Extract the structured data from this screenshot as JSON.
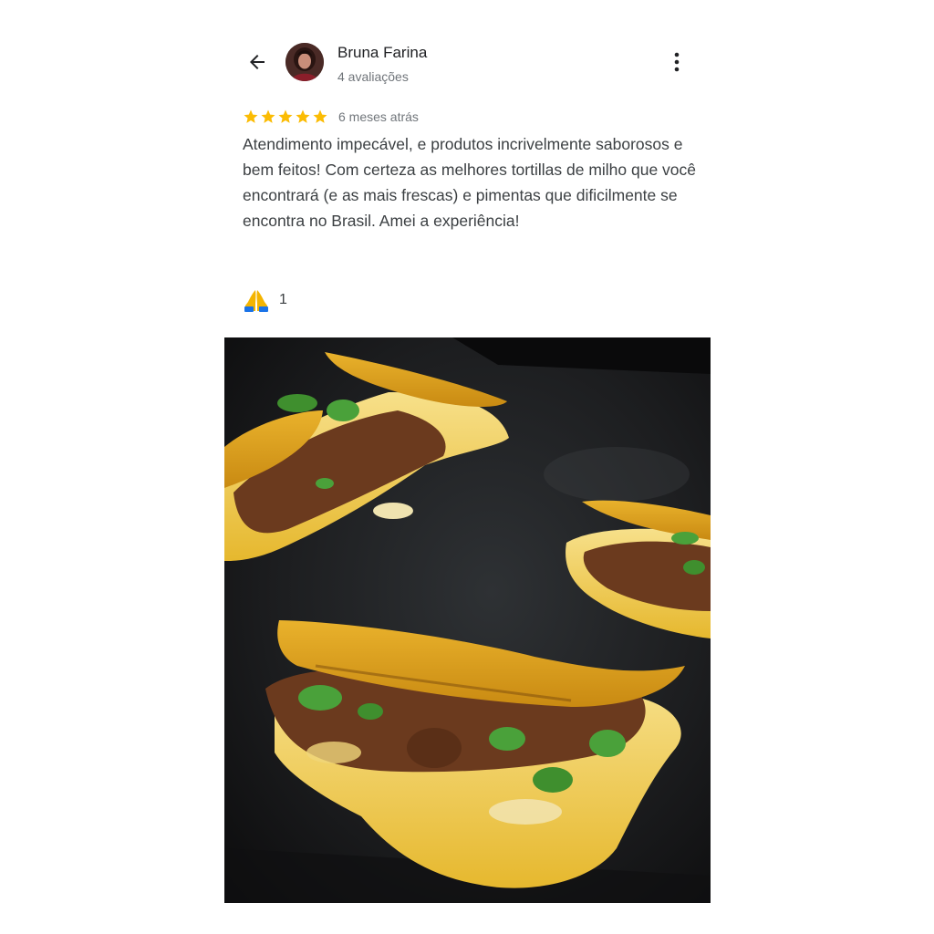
{
  "review": {
    "author": {
      "name": "Bruna Farina",
      "meta": "4 avaliações"
    },
    "rating": 5,
    "time_ago": "6 meses atrás",
    "text": "Atendimento impecável, e produtos incrivelmente saborosos e bem feitos! Com certeza as melhores tortillas de milho que você encontrará (e as mais frescas) e pimentas que dificilmente se encontra no Brasil. Amei a experiência!",
    "reaction": {
      "icon": "praying-hands-icon",
      "count": "1"
    },
    "photo": {
      "subject": "quesabirria tacos on a griddle"
    }
  },
  "colors": {
    "star": "#fbbc04",
    "text_primary": "#202124",
    "text_secondary": "#70757a",
    "body_text": "#3c4043"
  }
}
